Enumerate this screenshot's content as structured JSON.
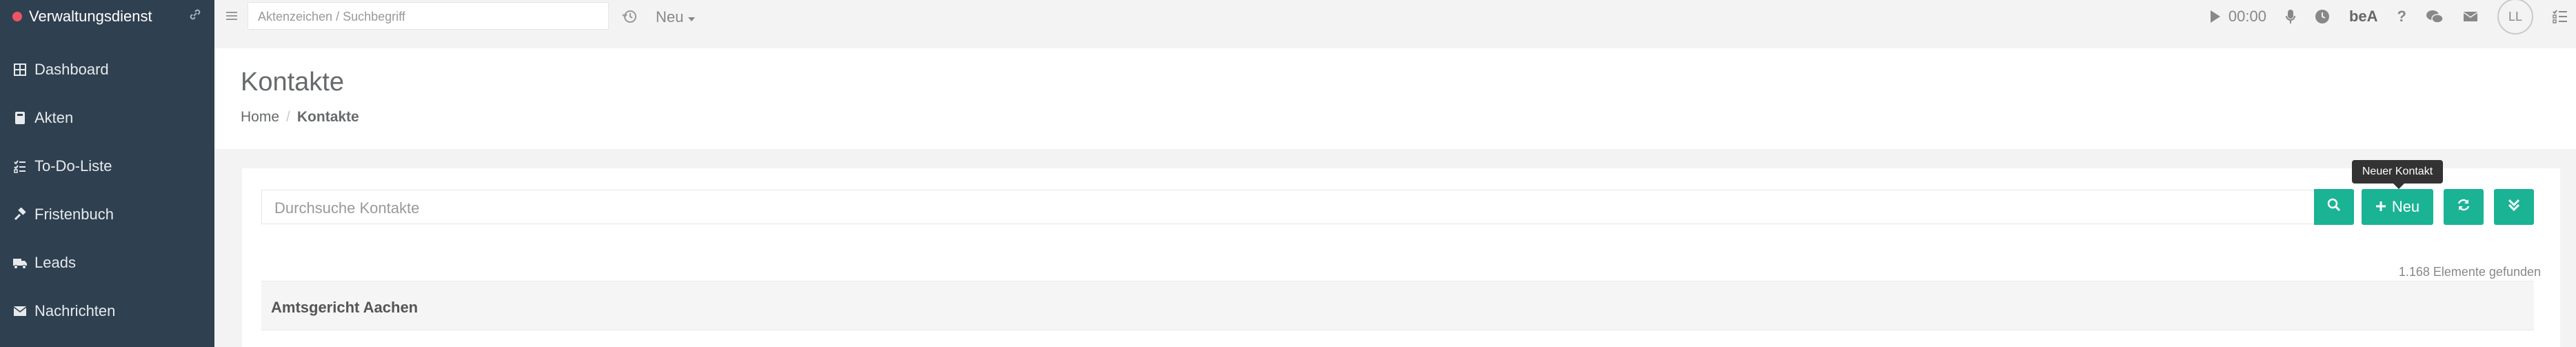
{
  "app": {
    "title": "Verwaltungsdienst"
  },
  "sidebar": {
    "items": [
      {
        "label": "Dashboard",
        "icon": "dashboard-icon"
      },
      {
        "label": "Akten",
        "icon": "book-icon"
      },
      {
        "label": "To-Do-Liste",
        "icon": "list-icon"
      },
      {
        "label": "Fristenbuch",
        "icon": "gavel-icon"
      },
      {
        "label": "Leads",
        "icon": "truck-icon"
      },
      {
        "label": "Nachrichten",
        "icon": "envelope-icon"
      }
    ]
  },
  "topbar": {
    "search_placeholder": "Aktenzeichen / Suchbegriff",
    "new_label": "Neu",
    "timer": "00:00",
    "bea_label": "beA",
    "help": "?",
    "avatar_initials": "LL"
  },
  "page": {
    "title": "Kontakte",
    "breadcrumb": {
      "home": "Home",
      "separator": "/",
      "current": "Kontakte"
    }
  },
  "contacts": {
    "search_placeholder": "Durchsuche Kontakte",
    "new_button_label": "Neu",
    "tooltip": "Neuer Kontakt",
    "count_text": "1.168 Elemente gefunden",
    "group_header": "Amtsgericht Aachen"
  },
  "colors": {
    "sidebar_bg": "#2f4050",
    "accent": "#1ab394",
    "brand_dot": "#ed5565"
  }
}
